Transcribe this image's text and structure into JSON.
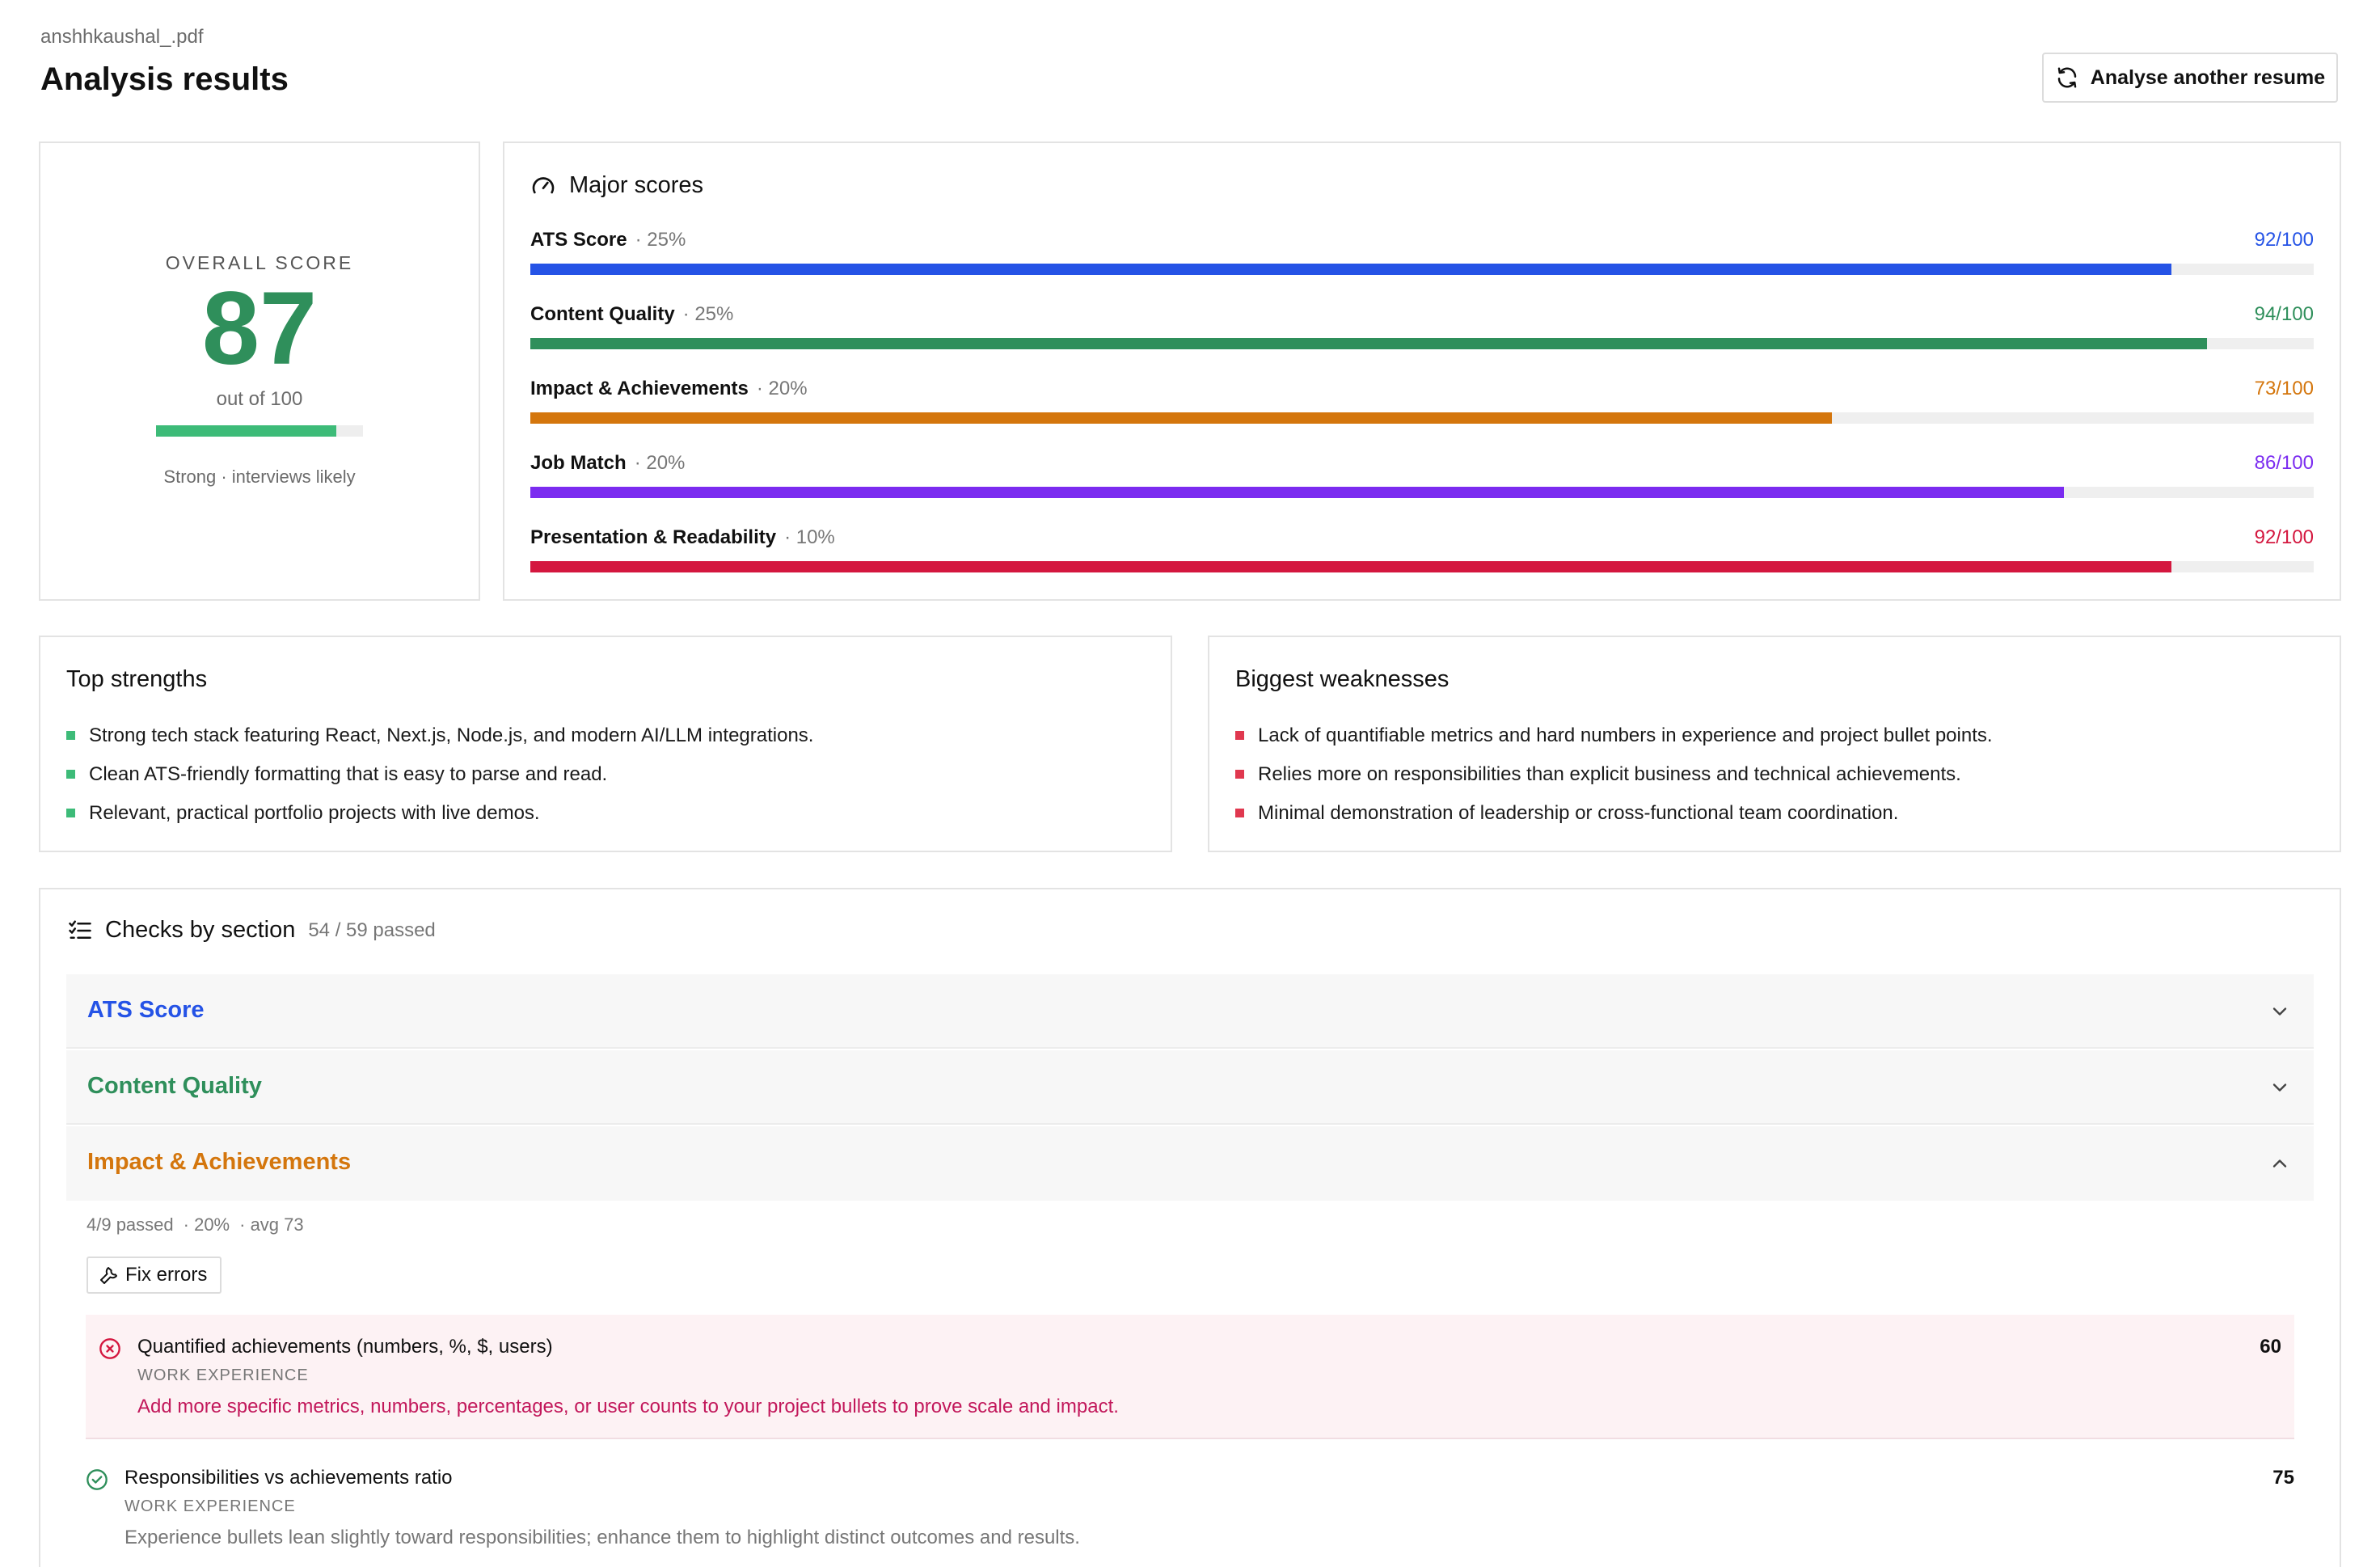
{
  "header": {
    "filename": "anshhkaushal_.pdf",
    "title": "Analysis results",
    "analyse_button": "Analyse another resume"
  },
  "overall": {
    "label": "OVERALL SCORE",
    "value": "87",
    "out_of": "out of 100",
    "progress_fraction": 0.87,
    "verdict": "Strong · interviews likely"
  },
  "major_scores": {
    "title": "Major scores",
    "items": [
      {
        "name": "ATS Score",
        "weight": "· 25%",
        "score_text": "92/100",
        "score": 92,
        "color": "#2553e6"
      },
      {
        "name": "Content Quality",
        "weight": "· 25%",
        "score_text": "94/100",
        "score": 94,
        "color": "#2f8f5b"
      },
      {
        "name": "Impact & Achievements",
        "weight": "· 20%",
        "score_text": "73/100",
        "score": 73,
        "color": "#d4760d"
      },
      {
        "name": "Job Match",
        "weight": "· 20%",
        "score_text": "86/100",
        "score": 86,
        "color": "#7b2cf0"
      },
      {
        "name": "Presentation & Readability",
        "weight": "· 10%",
        "score_text": "92/100",
        "score": 92,
        "color": "#d4173f"
      }
    ]
  },
  "strengths": {
    "title": "Top strengths",
    "items": [
      "Strong tech stack featuring React, Next.js, Node.js, and modern AI/LLM integrations.",
      "Clean ATS-friendly formatting that is easy to parse and read.",
      "Relevant, practical portfolio projects with live demos."
    ]
  },
  "weaknesses": {
    "title": "Biggest weaknesses",
    "items": [
      "Lack of quantifiable metrics and hard numbers in experience and project bullet points.",
      "Relies more on responsibilities than explicit business and technical achievements.",
      "Minimal demonstration of leadership or cross-functional team coordination."
    ]
  },
  "checks": {
    "title": "Checks by section",
    "passed": "54 / 59 passed",
    "sections": [
      {
        "label": "ATS Score",
        "color": "#2553e6",
        "expanded": false
      },
      {
        "label": "Content Quality",
        "color": "#2f8f5b",
        "expanded": false
      },
      {
        "label": "Impact & Achievements",
        "color": "#d4760d",
        "expanded": true
      }
    ],
    "expanded_meta": {
      "passed": "4/9 passed",
      "weight": "· 20%",
      "avg": "· avg 73"
    },
    "fix_button": "Fix errors",
    "items": [
      {
        "status": "fail",
        "title": "Quantified achievements (numbers, %, $, users)",
        "section": "WORK EXPERIENCE",
        "advice": "Add more specific metrics, numbers, percentages, or user counts to your project bullets to prove scale and impact.",
        "score": "60"
      },
      {
        "status": "pass",
        "title": "Responsibilities vs achievements ratio",
        "section": "WORK EXPERIENCE",
        "advice": "Experience bullets lean slightly toward responsibilities; enhance them to highlight distinct outcomes and results.",
        "score": "75"
      }
    ]
  }
}
